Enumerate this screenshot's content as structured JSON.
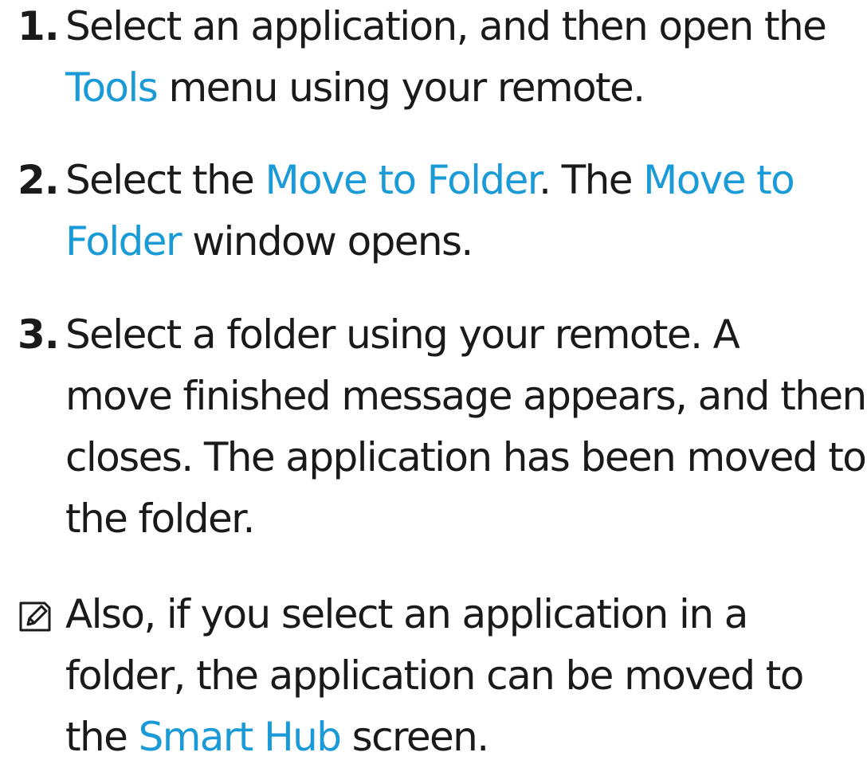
{
  "colors": {
    "text": "#1a1a1a",
    "highlight": "#1a9ad6"
  },
  "steps": [
    {
      "number": "1.",
      "lines": [
        {
          "a": "Select an application, and then open the"
        },
        {
          "hl": "Tools",
          "b": " menu using your remote."
        }
      ]
    },
    {
      "number": "2.",
      "lines": [
        {
          "a": "Select the ",
          "hl1": "Move to Folder",
          "b": ". The ",
          "hl2": "Move to"
        },
        {
          "hl": "Folder",
          "b": " window opens."
        }
      ]
    },
    {
      "number": "3.",
      "lines": [
        {
          "a": "Select a folder using your remote. A"
        },
        {
          "a": "move finished message appears, and then"
        },
        {
          "a": "closes. The application has been moved to"
        },
        {
          "a": "the folder."
        }
      ]
    }
  ],
  "note": {
    "icon": "note-pencil-icon",
    "lines": [
      {
        "a": "Also, if you select an application in a"
      },
      {
        "a": "folder, the application can be moved to"
      },
      {
        "a": "the ",
        "hl": "Smart Hub",
        "b": " screen."
      }
    ]
  }
}
